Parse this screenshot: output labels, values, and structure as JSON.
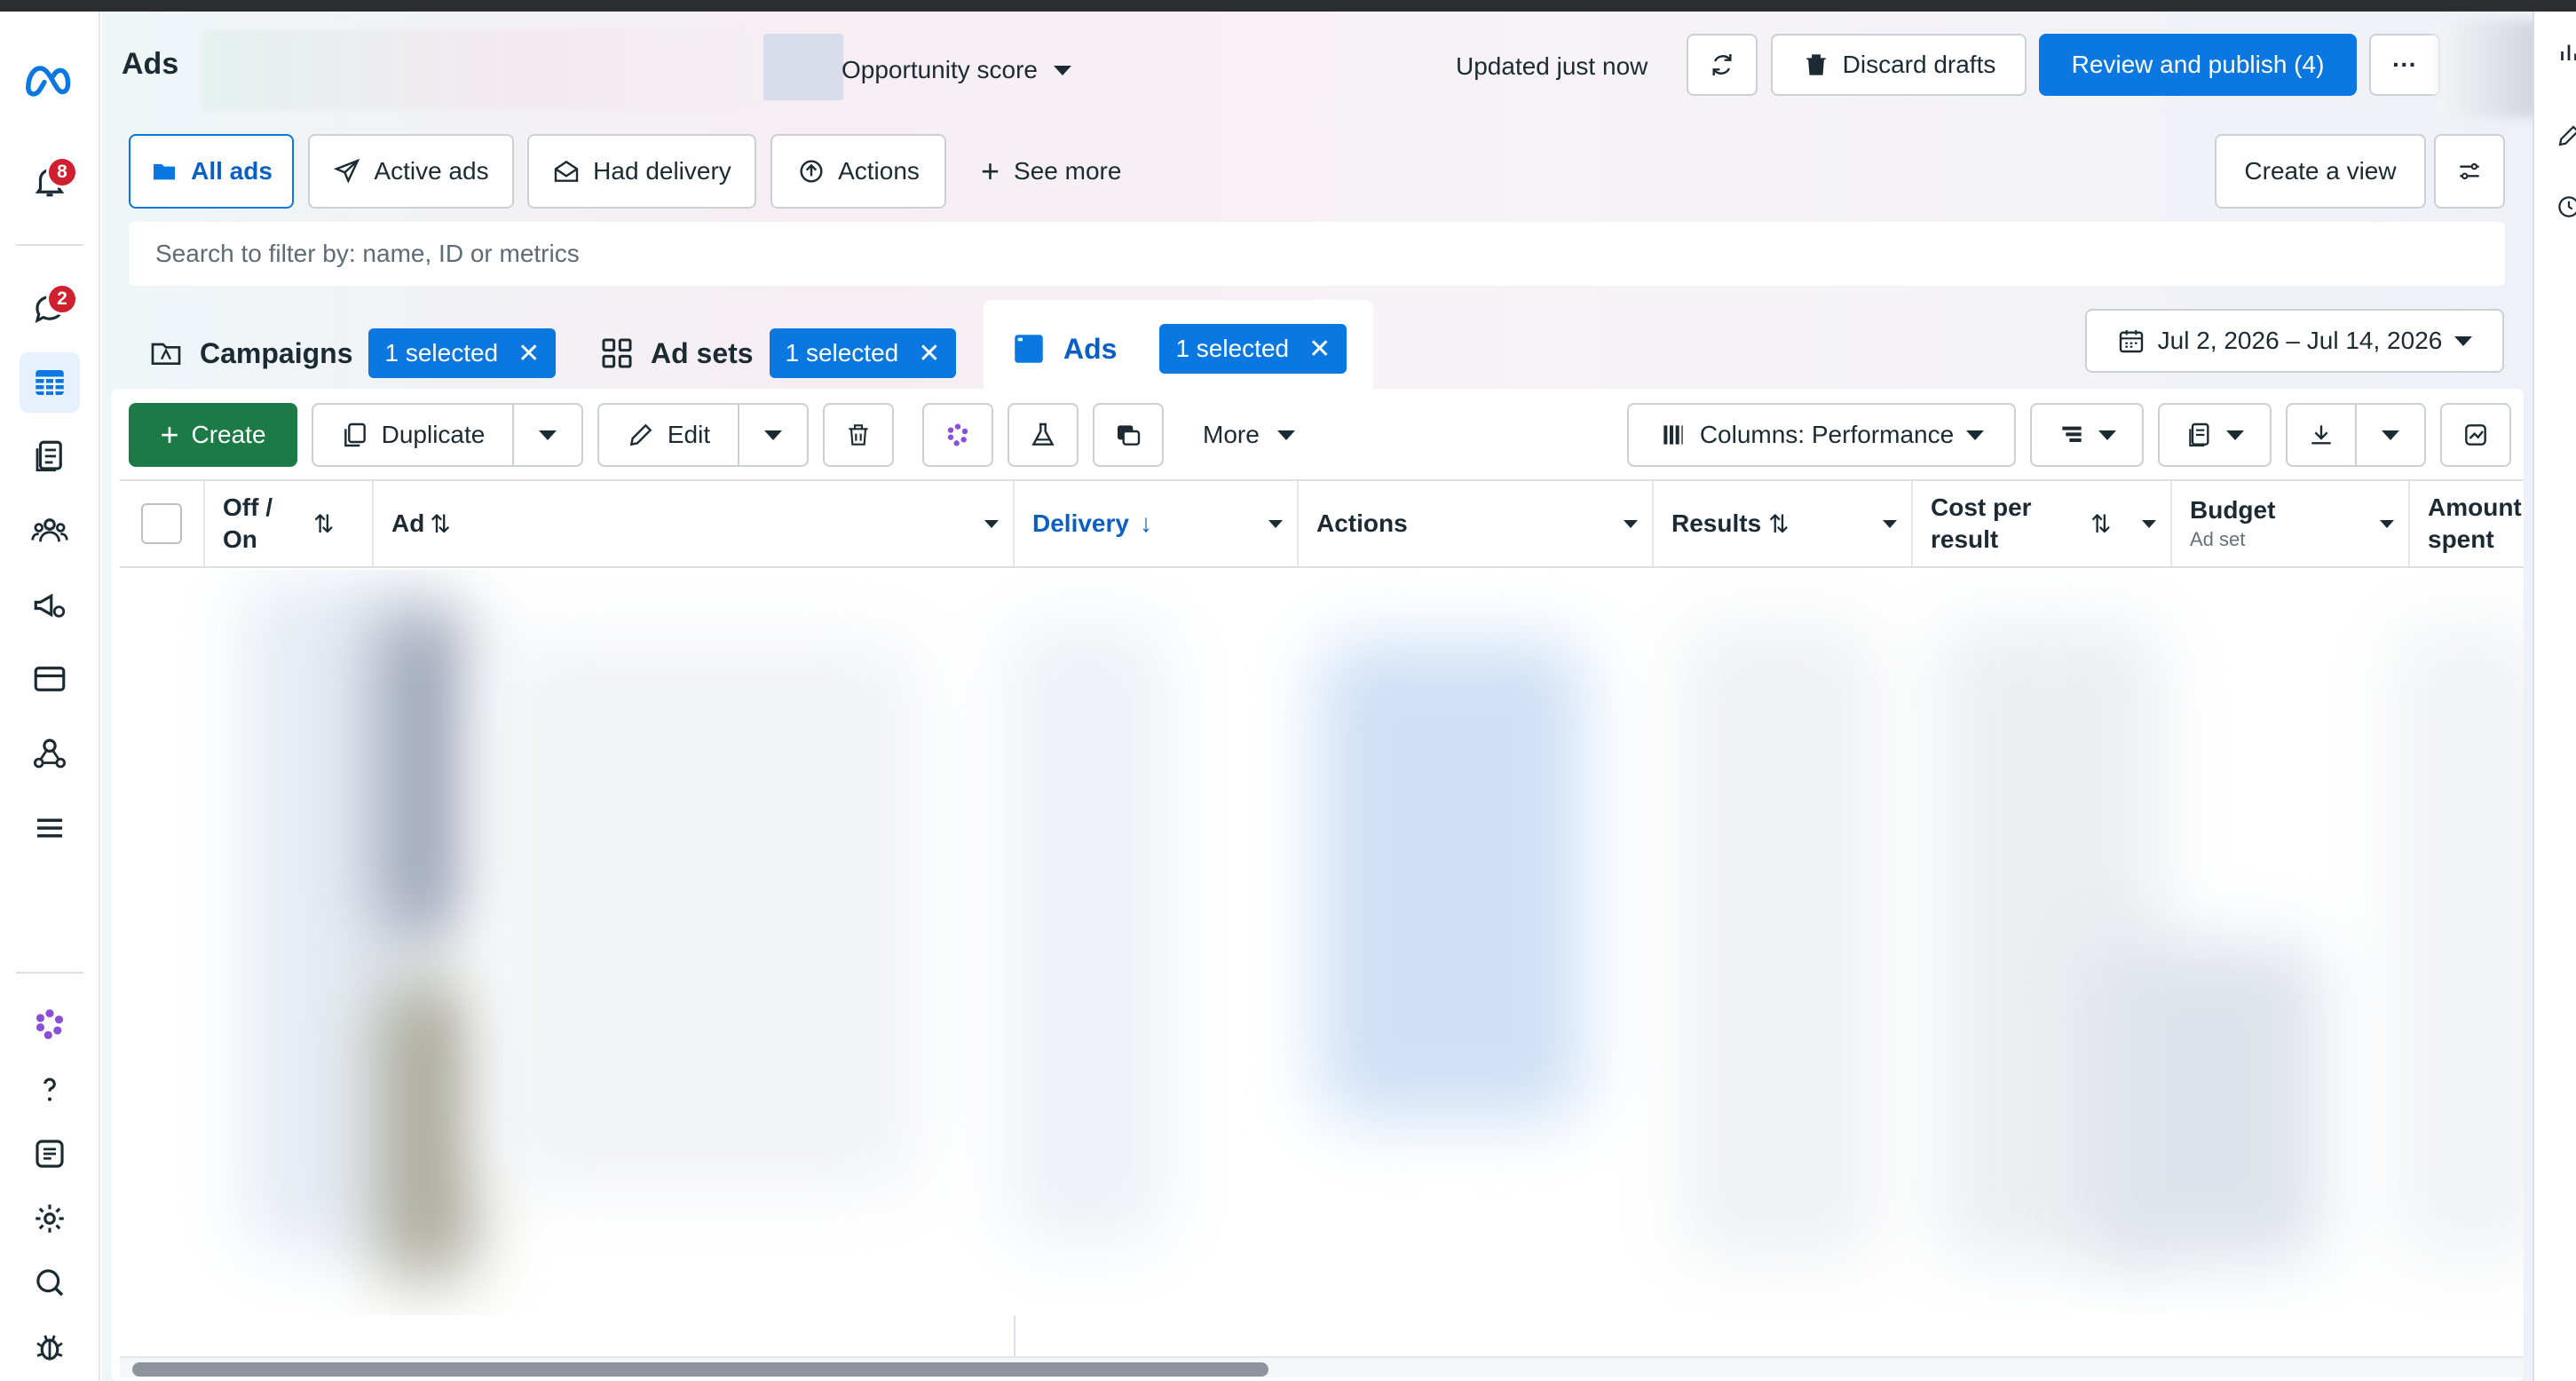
{
  "header": {
    "title": "Ads",
    "opportunity_label": "Opportunity score",
    "updated_text": "Updated just now",
    "discard_label": "Discard drafts",
    "publish_label": "Review and publish (4)",
    "more_label": "···"
  },
  "nav": {
    "notifications_badge": "8",
    "messages_badge": "2"
  },
  "views": {
    "all_ads": "All ads",
    "active_ads": "Active ads",
    "had_delivery": "Had delivery",
    "actions": "Actions",
    "see_more": "See more",
    "create_view": "Create a view"
  },
  "search": {
    "placeholder": "Search to filter by: name, ID or metrics"
  },
  "levels": {
    "campaigns": {
      "label": "Campaigns",
      "selected": "1 selected"
    },
    "adsets": {
      "label": "Ad sets",
      "selected": "1 selected"
    },
    "ads": {
      "label": "Ads",
      "selected": "1 selected"
    },
    "close_glyph": "✕"
  },
  "date_range": "Jul 2, 2026 – Jul 14, 2026",
  "toolbar": {
    "create": "Create",
    "duplicate": "Duplicate",
    "edit": "Edit",
    "more": "More",
    "columns": "Columns: Performance"
  },
  "table": {
    "columns": {
      "off_on": "Off / On",
      "ad": "Ad",
      "delivery": "Delivery",
      "actions": "Actions",
      "results": "Results",
      "cost_per_result": "Cost per result",
      "budget": "Budget",
      "budget_sub": "Ad set",
      "amount_spent": "Amount spent"
    }
  },
  "colors": {
    "accent": "#0a78e0",
    "create_green": "#1b7a46",
    "badge_red": "#d0202f"
  }
}
